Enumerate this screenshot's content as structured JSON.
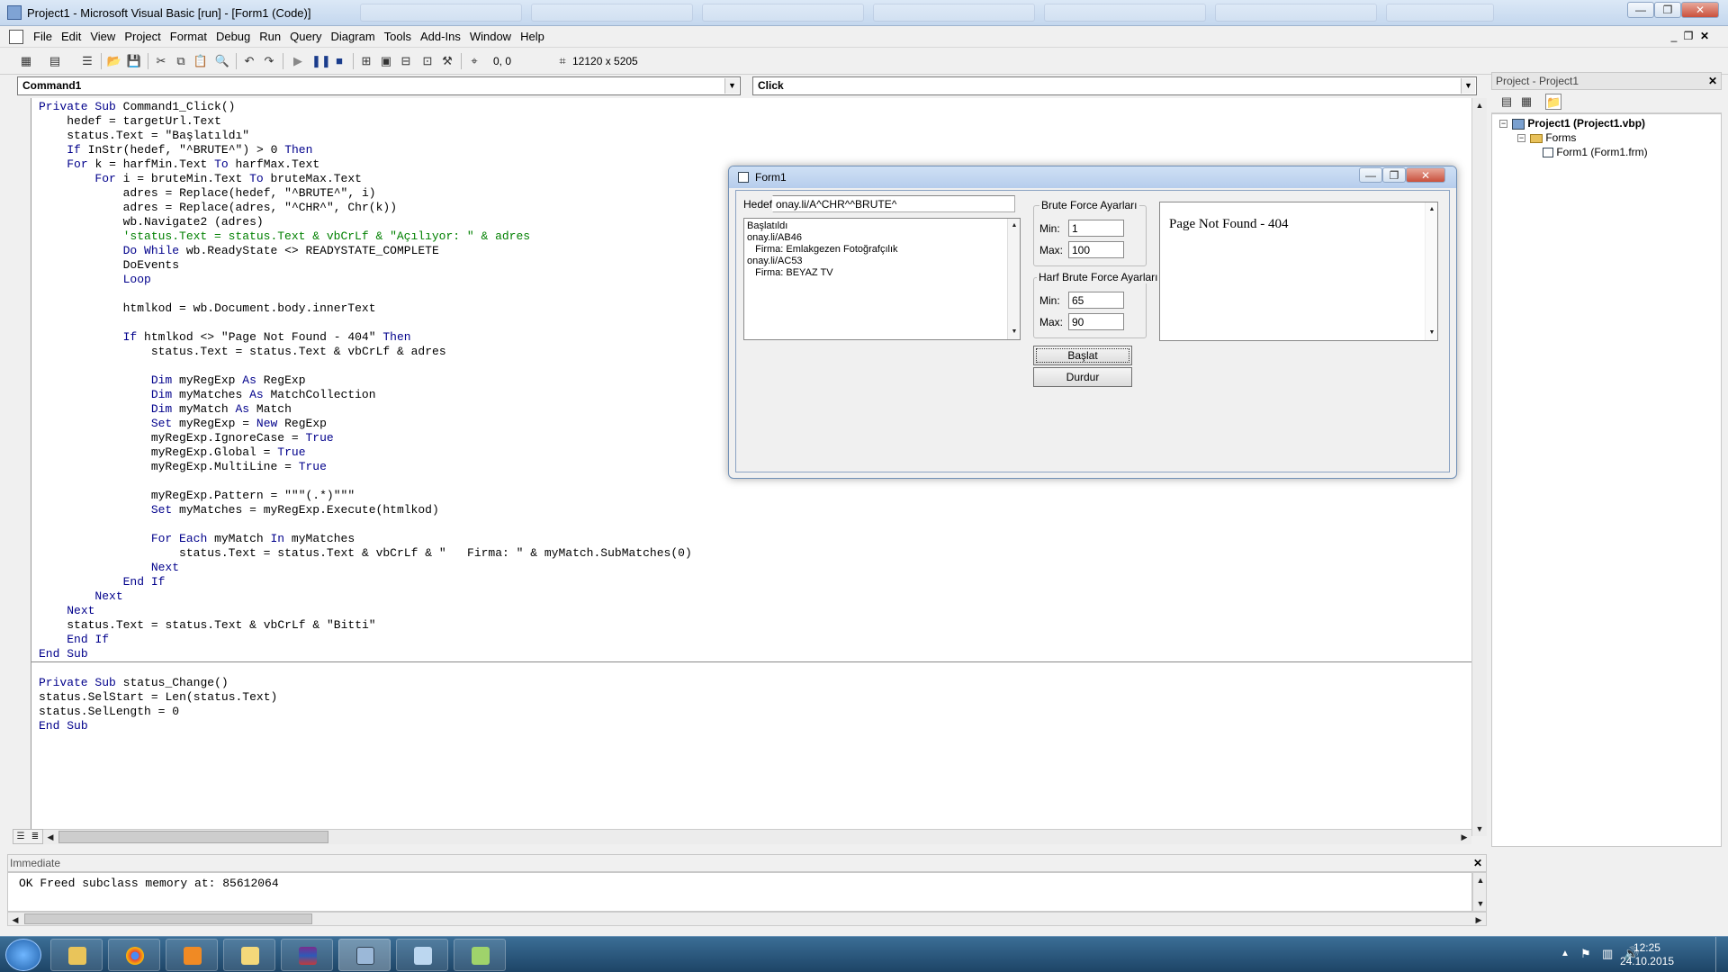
{
  "window": {
    "title": "Project1 - Microsoft Visual Basic [run] - [Form1 (Code)]",
    "min_glyph": "—",
    "max_glyph": "❐",
    "close_glyph": "✕"
  },
  "menu": {
    "items": [
      "File",
      "Edit",
      "View",
      "Project",
      "Format",
      "Debug",
      "Run",
      "Query",
      "Diagram",
      "Tools",
      "Add-Ins",
      "Window",
      "Help"
    ]
  },
  "toolbar": {
    "coords": "0, 0",
    "size": "12120 x 5205"
  },
  "code_window": {
    "object_combo": "Command1",
    "procedure_combo": "Click",
    "lines": [
      "Private Sub Command1_Click()",
      "    hedef = targetUrl.Text",
      "    status.Text = \"Başlatıldı\"",
      "    If InStr(hedef, \"^BRUTE^\") > 0 Then",
      "    For k = harfMin.Text To harfMax.Text",
      "        For i = bruteMin.Text To bruteMax.Text",
      "            adres = Replace(hedef, \"^BRUTE^\", i)",
      "            adres = Replace(adres, \"^CHR^\", Chr(k))",
      "            wb.Navigate2 (adres)",
      "            'status.Text = status.Text & vbCrLf & \"Açılıyor: \" & adres",
      "            Do While wb.ReadyState <> READYSTATE_COMPLETE",
      "            DoEvents",
      "            Loop",
      "",
      "            htmlkod = wb.Document.body.innerText",
      "",
      "            If htmlkod <> \"Page Not Found - 404\" Then",
      "                status.Text = status.Text & vbCrLf & adres",
      "",
      "                Dim myRegExp As RegExp",
      "                Dim myMatches As MatchCollection",
      "                Dim myMatch As Match",
      "                Set myRegExp = New RegExp",
      "                myRegExp.IgnoreCase = True",
      "                myRegExp.Global = True",
      "                myRegExp.MultiLine = True",
      "",
      "                myRegExp.Pattern = \"\"\"(.*)\"\"\"",
      "                Set myMatches = myRegExp.Execute(htmlkod)",
      "",
      "                For Each myMatch In myMatches",
      "                    status.Text = status.Text & vbCrLf & \"   Firma: \" & myMatch.SubMatches(0)",
      "                Next",
      "            End If",
      "        Next",
      "    Next",
      "    status.Text = status.Text & vbCrLf & \"Bitti\"",
      "    End If",
      "End Sub",
      "",
      "Private Sub status_Change()",
      "status.SelStart = Len(status.Text)",
      "status.SelLength = 0",
      "End Sub"
    ]
  },
  "immediate": {
    "title": "Immediate",
    "output": "OK Freed subclass memory at: 85612064"
  },
  "project_panel": {
    "title": "Project - Project1",
    "root": "Project1 (Project1.vbp)",
    "folder": "Forms",
    "file": "Form1 (Form1.frm)"
  },
  "form1": {
    "title": "Form1",
    "hedef_label": "Hedef:",
    "hedef_value": "onay.li/A^CHR^^BRUTE^",
    "status_lines": [
      "Başlatıldı",
      "onay.li/AB46",
      "   Firma: Emlakgezen Fotoğrafçılık",
      "onay.li/AC53",
      "   Firma: BEYAZ TV"
    ],
    "brute_group": "Brute Force Ayarları",
    "harf_group": "Harf Brute Force Ayarları",
    "min_label": "Min:",
    "max_label": "Max:",
    "brute_min": "1",
    "brute_max": "100",
    "harf_min": "65",
    "harf_max": "90",
    "start_button": "Başlat",
    "stop_button": "Durdur",
    "browser_text": "Page Not Found - 404"
  },
  "taskbar": {
    "apps": [
      "explorer",
      "chrome",
      "media-player",
      "folder",
      "winrar",
      "vb6",
      "notepad",
      "notepad-plus"
    ],
    "time": "12:25",
    "date": "24.10.2015"
  }
}
